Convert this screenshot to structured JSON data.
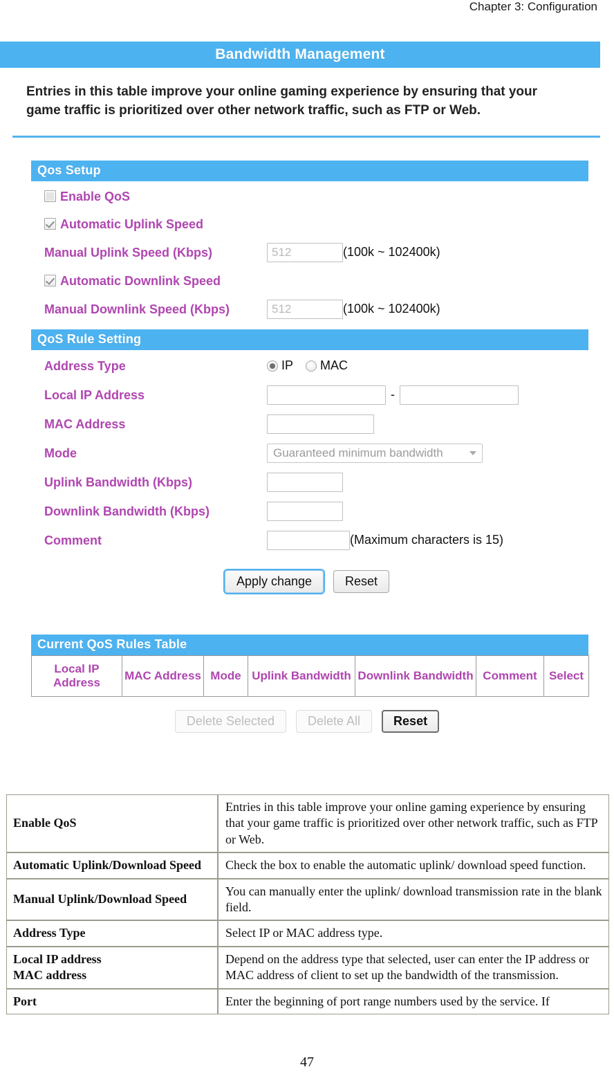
{
  "running_head": "Chapter 3: Configuration",
  "page_number": "47",
  "router_panel": {
    "title": "Bandwidth Management",
    "intro": "Entries in this table improve your online gaming experience by ensuring that your game traffic is prioritized over other network traffic, such as FTP or Web.",
    "qos_setup": {
      "section_title": "Qos Setup",
      "enable_qos_label": "Enable QoS",
      "enable_qos_checked": false,
      "auto_uplink_label": "Automatic Uplink Speed",
      "auto_uplink_checked": true,
      "manual_uplink_label": "Manual Uplink Speed (Kbps)",
      "manual_uplink_value": "512",
      "manual_uplink_hint": "(100k ~ 102400k)",
      "auto_downlink_label": "Automatic Downlink Speed",
      "auto_downlink_checked": true,
      "manual_downlink_label": "Manual Downlink Speed (Kbps)",
      "manual_downlink_value": "512",
      "manual_downlink_hint": "(100k ~ 102400k)"
    },
    "qos_rule_setting": {
      "section_title": "QoS Rule Setting",
      "address_type_label": "Address Type",
      "address_type_options": [
        "IP",
        "MAC"
      ],
      "address_type_selected": "IP",
      "local_ip_label": "Local IP Address",
      "local_ip_start_value": "",
      "local_ip_end_value": "",
      "local_ip_separator": "-",
      "mac_address_label": "MAC Address",
      "mac_address_value": "",
      "mode_label": "Mode",
      "mode_selected": "Guaranteed minimum bandwidth",
      "uplink_bw_label": "Uplink Bandwidth (Kbps)",
      "uplink_bw_value": "",
      "downlink_bw_label": "Downlink Bandwidth (Kbps)",
      "downlink_bw_value": "",
      "comment_label": "Comment",
      "comment_value": "",
      "comment_hint": "(Maximum characters is 15)",
      "apply_button": "Apply change",
      "reset_button": "Reset"
    },
    "rules_table": {
      "section_title": "Current QoS Rules Table",
      "columns": [
        "Local IP Address",
        "MAC Address",
        "Mode",
        "Uplink Bandwidth",
        "Downlink Bandwidth",
        "Comment",
        "Select"
      ],
      "rows": [],
      "delete_selected_button": "Delete Selected",
      "delete_all_button": "Delete All",
      "reset_button": "Reset"
    }
  },
  "doc_table": {
    "rows": [
      {
        "key": "Enable QoS",
        "value": "Entries in this table improve your online gaming experience by ensuring that your game traffic is prioritized over other network traffic, such as FTP or Web."
      },
      {
        "key": "Automatic Uplink/Download Speed",
        "value": "Check the box to enable the automatic uplink/ download speed function."
      },
      {
        "key": "Manual Uplink/Download Speed",
        "value": "You can manually enter the uplink/ download transmission rate in the blank field."
      },
      {
        "key": "Address Type",
        "value": "Select IP or MAC address type."
      },
      {
        "key": "Local IP address\nMAC address",
        "value": "Depend on the address type that selected, user can enter the IP address or MAC address of client to set up the bandwidth of the transmission."
      },
      {
        "key": "Port",
        "value": "Enter the beginning of port range numbers used by the service. If"
      }
    ]
  },
  "colors": {
    "accent_blue": "#4db2f0",
    "label_magenta": "#b046b0",
    "doc_border": "#9c9c8e"
  }
}
